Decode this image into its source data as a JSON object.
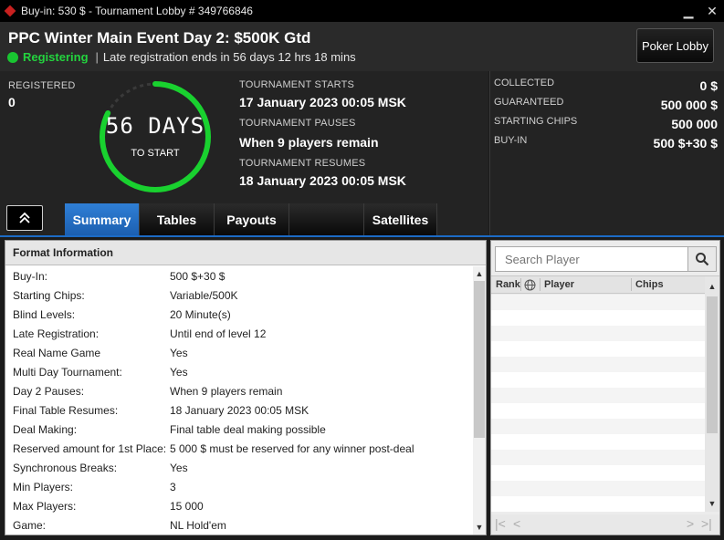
{
  "window": {
    "title": "Buy-in: 530 $ - Tournament Lobby # 349766846",
    "minimize": "▁",
    "close": "✕"
  },
  "header": {
    "event_title": "PPC Winter Main Event Day 2: $500K Gtd",
    "status": "Registering",
    "separator": "|",
    "late_reg": "Late registration ends in 56 days 12 hrs  18 mins",
    "lobby_button": "Poker Lobby"
  },
  "info": {
    "registered_label": "REGISTERED",
    "registered_value": "0",
    "countdown_main": "56 DAYS",
    "countdown_sub": "TO START",
    "starts_label": "TOURNAMENT STARTS",
    "starts_value": "17 January 2023  00:05 MSK",
    "pauses_label": "TOURNAMENT PAUSES",
    "pauses_value": "When 9 players remain",
    "resumes_label": "TOURNAMENT RESUMES",
    "resumes_value": "18 January 2023  00:05 MSK",
    "collected_label": "COLLECTED",
    "collected_value": "0 $",
    "guaranteed_label": "GUARANTEED",
    "guaranteed_value": "500 000 $",
    "chips_label": "STARTING CHIPS",
    "chips_value": "500 000",
    "buyin_label": "BUY-IN",
    "buyin_value": "500 $+30 $"
  },
  "tabs": [
    {
      "label": "Summary",
      "active": true
    },
    {
      "label": "Tables",
      "active": false
    },
    {
      "label": "Payouts",
      "active": false
    },
    {
      "label": "",
      "active": false
    },
    {
      "label": "Satellites",
      "active": false
    }
  ],
  "format": {
    "heading": "Format Information",
    "rows": [
      {
        "k": "Buy-In:",
        "v": "500 $+30 $"
      },
      {
        "k": "Starting Chips:",
        "v": "Variable/500K"
      },
      {
        "k": "Blind Levels:",
        "v": "20 Minute(s)"
      },
      {
        "k": "Late Registration:",
        "v": "Until end of level 12"
      },
      {
        "k": "Real Name Game",
        "v": "Yes"
      },
      {
        "k": "Multi Day Tournament:",
        "v": "Yes"
      },
      {
        "k": "Day 2 Pauses:",
        "v": "When 9 players remain"
      },
      {
        "k": "Final Table Resumes:",
        "v": "18 January 2023  00:05 MSK"
      },
      {
        "k": "Deal Making:",
        "v": "Final table deal making possible"
      },
      {
        "k": "Reserved amount for 1st Place:",
        "v": "5 000 $ must be reserved for any winner post-deal"
      },
      {
        "k": "Synchronous Breaks:",
        "v": "Yes"
      },
      {
        "k": "Min Players:",
        "v": "3"
      },
      {
        "k": "Max Players:",
        "v": "15 000"
      },
      {
        "k": "Game:",
        "v": "NL Hold'em"
      }
    ]
  },
  "players": {
    "search_placeholder": "Search Player",
    "col_rank": "Rank",
    "col_player": "Player",
    "col_chips": "Chips",
    "pager_first": "|<",
    "pager_prev": "<",
    "pager_next": ">",
    "pager_last": ">|"
  },
  "colors": {
    "accent_blue": "#1c6bc6",
    "status_green": "#23d33e"
  }
}
